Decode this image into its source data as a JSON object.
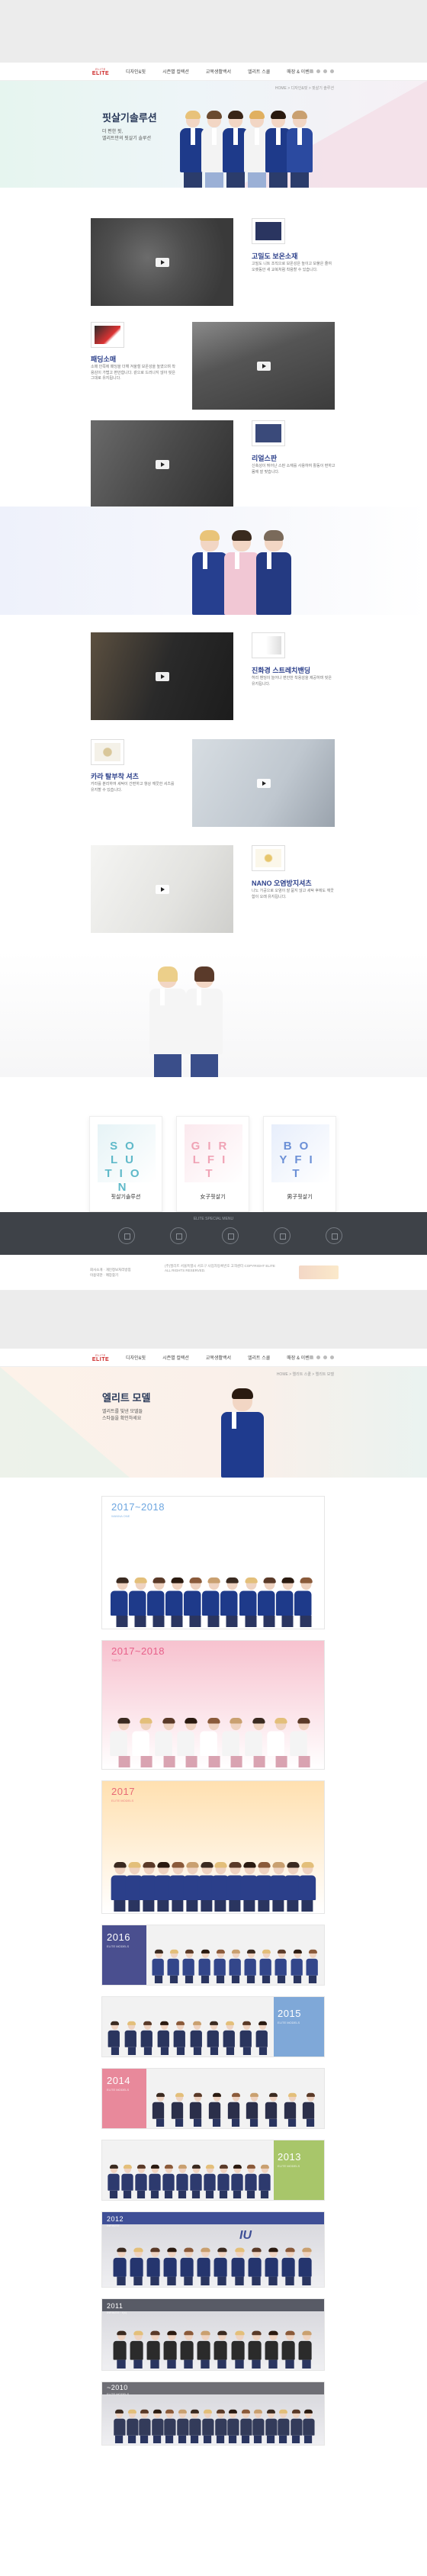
{
  "header": {
    "logo_small": "ELITE",
    "logo_main": "ELITE",
    "nav": [
      "디자인&핏",
      "시즌별 컬렉션",
      "교복생활백서",
      "엘리트 스쿨",
      "매장 & 이벤트"
    ]
  },
  "hero1": {
    "crumb": "HOME > 디자인&핏 > 핏살기 솔루션",
    "title": "핏살기솔루션",
    "line1": "더 편한 핏,",
    "line2": "엘리트만의 핏살기 솔루션"
  },
  "features": [
    {
      "title": "고밀도 보온소재",
      "desc": "고밀도 니트 조직으로 보온성은 높이고 보풀은 줄여 오랫동안 새 교복처럼 착용할 수 있습니다."
    },
    {
      "title": "패딩소매",
      "desc": "소매 안쪽에 패딩을 더해 겨울철 보온성을 높였으며 착용감이 가볍고 편안합니다. 겉으로 드러나지 않아 핏은 그대로 유지됩니다."
    },
    {
      "title": "리얼스판",
      "desc": "신축성이 뛰어난 스판 소재를 사용하여 활동이 편하고 몸에 잘 맞습니다."
    },
    {
      "title": "진화경 스트레치밴딩",
      "desc": "허리 밴딩이 늘어나 편안한 착용감을 제공하며 핏은 유지됩니다."
    },
    {
      "title": "카라 탈부착 셔츠",
      "desc": "카라를 분리하여 세탁이 간편하고 항상 깨끗한 셔츠를 유지할 수 있습니다."
    },
    {
      "title": "NANO 오염방지셔츠",
      "desc": "나노 가공으로 오염이 잘 묻지 않고 세탁 후에도 깨끗함이 오래 유지됩니다."
    }
  ],
  "fit_cards": [
    {
      "word": "SOLUTION",
      "label": "핏살기솔루션",
      "color": "#5fb9c9"
    },
    {
      "word": "GIRLFIT",
      "label": "女子핏살기",
      "color": "#f0a3b5"
    },
    {
      "word": "BOYFIT",
      "label": "男子핏살기",
      "color": "#6b8fd6"
    }
  ],
  "darkbar_title": "ELITE SPECIAL MENU",
  "footer": {
    "links": [
      "회사소개",
      "개인정보처리방침",
      "이용약관",
      "매장찾기"
    ],
    "address": "(주)엘리트 서울특별시 서초구 사업자등록번호 고객센터 COPYRIGHT ELITE ALL RIGHTS RESERVED."
  },
  "hero2": {
    "crumb": "HOME > 엘리트 스쿨 > 엘리트 모델",
    "title": "엘리트 모델",
    "line1": "엘리트를 빛낸 모델들",
    "line2": "스타들을 확인하세요"
  },
  "models": [
    {
      "year": "2017~2018",
      "sub": "WANNA ONE",
      "bg": "#ffffff",
      "accent": "#6da6e0",
      "count": 11,
      "uni": "#1e3a8a"
    },
    {
      "year": "2017~2018",
      "sub": "TWICE",
      "bg": "#f7c2cf",
      "accent": "#e7608a",
      "count": 9,
      "uni": "#f4f4f4"
    },
    {
      "year": "2017",
      "sub": "ELITE MODELS",
      "bg": "#ffe0b0",
      "accent": "#e86a75",
      "count": 14,
      "uni": "#2b3f8a"
    },
    {
      "year": "2016",
      "sub": "ELITE MODELS",
      "bg": "#4a4f8f",
      "accent": "#ffffff",
      "count": 11,
      "uni": "#33468a"
    },
    {
      "year": "2015",
      "sub": "ELITE MODELS",
      "bg": "#7fa8d8",
      "accent": "#ffffff",
      "count": 10,
      "uni": "#2a355e"
    },
    {
      "year": "2014",
      "sub": "ELITE MODELS",
      "bg": "#e8899b",
      "accent": "#ffffff",
      "count": 9,
      "uni": "#2b2f4a"
    },
    {
      "year": "2013",
      "sub": "ELITE MODELS",
      "bg": "#a8c66a",
      "accent": "#ffffff",
      "count": 12,
      "uni": "#2d3a6e"
    },
    {
      "year": "2012",
      "sub": "INFINITE",
      "bg": "#3f4f96",
      "accent": "#ffffff",
      "count": 12,
      "uni": "#25356e",
      "extra": "IU"
    },
    {
      "year": "2011",
      "sub": "INFINITE · f(x)",
      "bg": "#585b66",
      "accent": "#ffffff",
      "count": 12,
      "uni": "#2b2b2b"
    },
    {
      "year": "~2010",
      "sub": "ELITE MODELS",
      "bg": "#6e6e75",
      "accent": "#ffffff",
      "count": 16,
      "uni": "#333b5a"
    }
  ]
}
